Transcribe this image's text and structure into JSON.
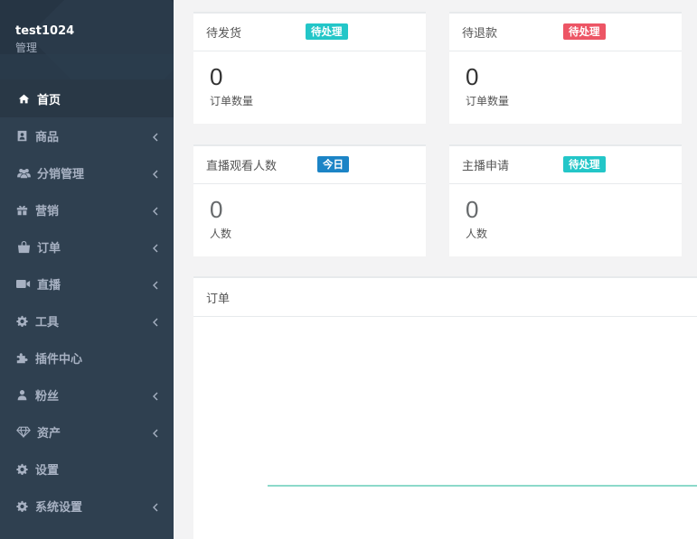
{
  "sidebar": {
    "username": "test1024",
    "role": "管理",
    "items": [
      {
        "label": "首页",
        "icon": "home-icon",
        "active": true,
        "has_arrow": false
      },
      {
        "label": "商品",
        "icon": "contact-card-icon",
        "active": false,
        "has_arrow": true
      },
      {
        "label": "分销管理",
        "icon": "users-icon",
        "active": false,
        "has_arrow": true
      },
      {
        "label": "营销",
        "icon": "gift-icon",
        "active": false,
        "has_arrow": true
      },
      {
        "label": "订单",
        "icon": "shopping-bag-icon",
        "active": false,
        "has_arrow": true
      },
      {
        "label": "直播",
        "icon": "video-camera-icon",
        "active": false,
        "has_arrow": true
      },
      {
        "label": "工具",
        "icon": "gear-icon",
        "active": false,
        "has_arrow": true
      },
      {
        "label": "插件中心",
        "icon": "puzzle-icon",
        "active": false,
        "has_arrow": false
      },
      {
        "label": "粉丝",
        "icon": "user-icon",
        "active": false,
        "has_arrow": true
      },
      {
        "label": "资产",
        "icon": "diamond-icon",
        "active": false,
        "has_arrow": true
      },
      {
        "label": "设置",
        "icon": "gear-icon",
        "active": false,
        "has_arrow": false
      },
      {
        "label": "系统设置",
        "icon": "gear-icon",
        "active": false,
        "has_arrow": true
      }
    ]
  },
  "cards": {
    "pending_shipment": {
      "title": "待发货",
      "badge": "待处理",
      "value": "0",
      "label": "订单数量"
    },
    "pending_refund": {
      "title": "待退款",
      "badge": "待处理",
      "value": "0",
      "label": "订单数量"
    },
    "live_viewers": {
      "title": "直播观看人数",
      "badge": "今日",
      "value": "0",
      "label": "人数"
    },
    "anchor_applications": {
      "title": "主播申请",
      "badge": "待处理",
      "value": "0",
      "label": "人数"
    }
  },
  "orders": {
    "title": "订单",
    "line_color": "#1ab394"
  },
  "colors": {
    "sidebar_bg": "#2f4050",
    "badge_teal": "#23c6c8",
    "badge_red": "#ed5565",
    "badge_blue": "#1c84c6"
  }
}
